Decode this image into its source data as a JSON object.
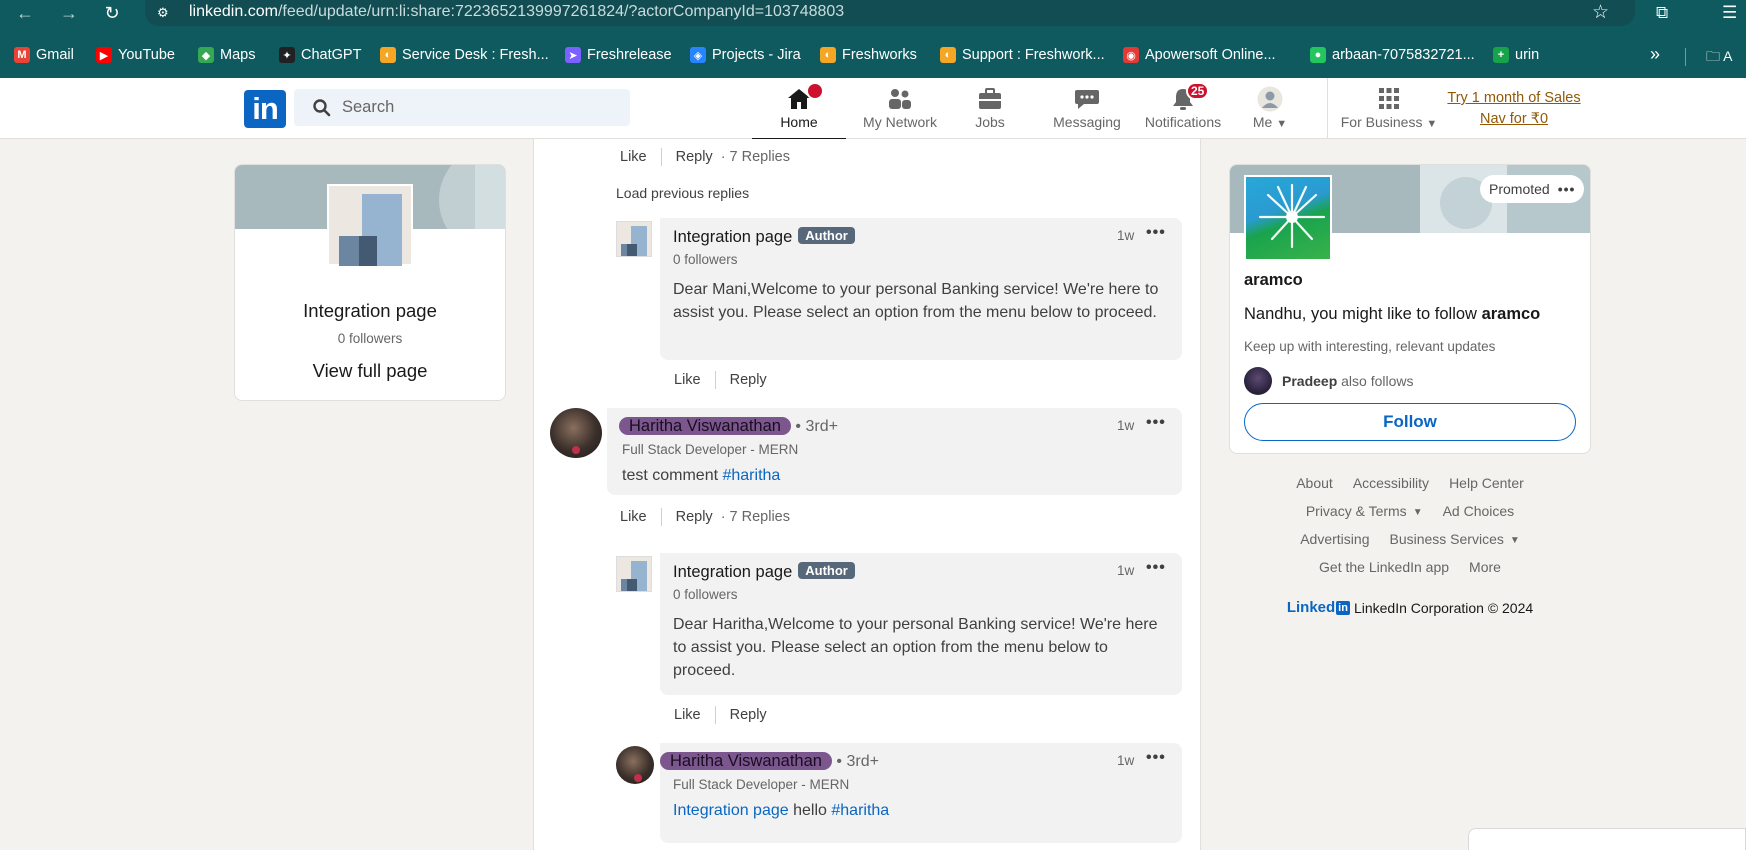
{
  "browser": {
    "url_host": "linkedin.com",
    "url_path": "/feed/update/urn:li:share:7223652139997261824/?actorCompanyId=103748803",
    "bookmarks": [
      {
        "label": "Gmail",
        "color": "#ea4335",
        "glyph": "M"
      },
      {
        "label": "YouTube",
        "color": "#ff0000",
        "glyph": "▶"
      },
      {
        "label": "Maps",
        "color": "#34a853",
        "glyph": "◆"
      },
      {
        "label": "ChatGPT",
        "color": "#202123",
        "glyph": "✦"
      },
      {
        "label": "Service Desk : Fresh...",
        "color": "#f4a624",
        "glyph": "◐"
      },
      {
        "label": "Freshrelease",
        "color": "#7b61ff",
        "glyph": "➤"
      },
      {
        "label": "Projects - Jira",
        "color": "#2684ff",
        "glyph": "◈"
      },
      {
        "label": "Freshworks",
        "color": "#f4a624",
        "glyph": "◐"
      },
      {
        "label": "Support : Freshwork...",
        "color": "#f4a624",
        "glyph": "◐"
      },
      {
        "label": "Apowersoft Online...",
        "color": "#e53935",
        "glyph": "◉"
      },
      {
        "label": "arbaan-7075832721...",
        "color": "#22c55e",
        "glyph": "●"
      },
      {
        "label": "urin",
        "color": "#16a34a",
        "glyph": "+"
      }
    ],
    "folder_label": "A"
  },
  "header": {
    "logo_text": "in",
    "search_placeholder": "Search",
    "nav": [
      {
        "label": "Home",
        "badge": "",
        "active": true
      },
      {
        "label": "My Network",
        "badge": ""
      },
      {
        "label": "Jobs",
        "badge": ""
      },
      {
        "label": "Messaging",
        "badge": ""
      },
      {
        "label": "Notifications",
        "badge": "25"
      },
      {
        "label": "Me",
        "badge": ""
      },
      {
        "label": "For Business",
        "badge": ""
      }
    ],
    "premium_line1": "Try 1 month of Sales",
    "premium_line2": "Nav for ₹0"
  },
  "profile_card": {
    "name": "Integration page",
    "followers": "0 followers",
    "view_link": "View full page"
  },
  "feed": {
    "top_actions": {
      "like": "Like",
      "reply": "Reply",
      "replies": "7 Replies"
    },
    "load_previous": "Load previous replies",
    "reply1": {
      "name": "Integration page",
      "badge": "Author",
      "followers": "0 followers",
      "time": "1w",
      "text": "Dear Mani,Welcome to your personal Banking service! We're here to assist you. Please select an option from the menu below to proceed.",
      "like": "Like",
      "reply": "Reply"
    },
    "comment2": {
      "name": "Haritha Viswanathan",
      "degree": "• 3rd+",
      "headline": "Full Stack Developer - MERN",
      "time": "1w",
      "text": "test comment",
      "hashtag": "#haritha",
      "like": "Like",
      "reply": "Reply",
      "replies": "7 Replies"
    },
    "reply2": {
      "name": "Integration page",
      "badge": "Author",
      "followers": "0 followers",
      "time": "1w",
      "text": "Dear Haritha,Welcome to your personal Banking service! We're here to assist you. Please select an option from the menu below to proceed.",
      "like": "Like",
      "reply": "Reply"
    },
    "reply3": {
      "name": "Haritha Viswanathan",
      "degree": "• 3rd+",
      "headline": "Full Stack Developer - MERN",
      "time": "1w",
      "mention": "Integration page",
      "text": "hello",
      "hashtag": "#haritha"
    }
  },
  "ad": {
    "promoted": "Promoted",
    "company": "aramco",
    "pitch_prefix": "Nandhu, you might like to follow",
    "pitch_company": "aramco",
    "description": "Keep up with interesting, relevant updates",
    "social_name": "Pradeep",
    "social_suffix": "also follows",
    "follow_label": "Follow"
  },
  "footer": {
    "row1": [
      "About",
      "Accessibility",
      "Help Center"
    ],
    "row2_a": "Privacy & Terms",
    "row2_b": "Ad Choices",
    "row3_a": "Advertising",
    "row3_b": "Business Services",
    "row4": [
      "Get the LinkedIn app",
      "More"
    ],
    "wordmark": "Linked",
    "wordmark_in": "in",
    "copyright": "LinkedIn Corporation © 2024"
  },
  "colors": {
    "brand": "#0a66c2",
    "chrome": "#0e5a5e",
    "badge": "#cb112d",
    "premium": "#915907"
  }
}
